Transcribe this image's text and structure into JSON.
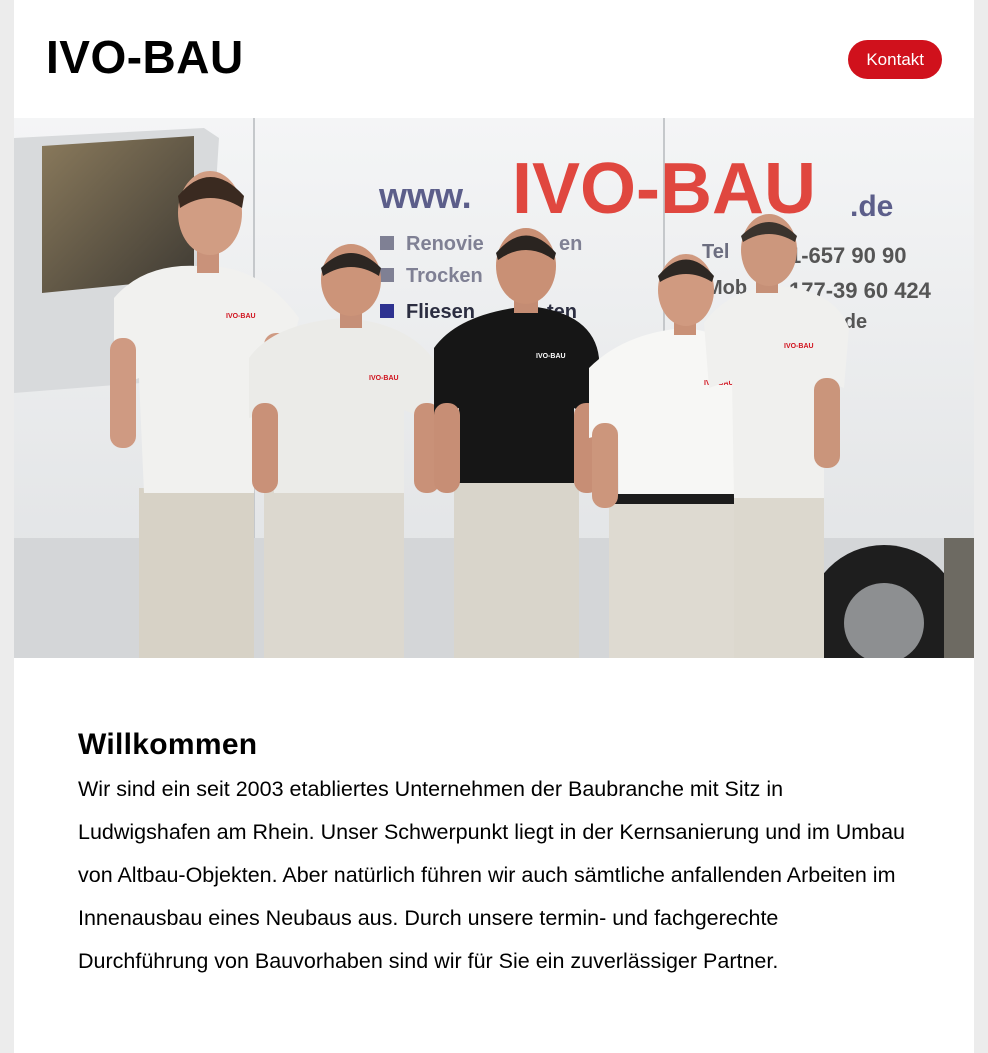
{
  "header": {
    "logo": "IVO-BAU",
    "contact_button": "Kontakt"
  },
  "hero": {
    "van_url_prefix": "www.",
    "van_brand": "IVO-BAU",
    "van_url_suffix": ".de",
    "van_services": [
      "Renovie",
      "Trocken",
      "Fliesen"
    ],
    "van_services_tail": [
      "en",
      "",
      "ten"
    ],
    "van_tel": "Tel",
    "van_tel_number": "1-657 90 90",
    "van_mobile": "Mob",
    "van_mobile_number": "177-39 60 424",
    "van_web_tail": "u.de",
    "shirt_logo": "IVO-BAU",
    "colors": {
      "brand_red": "#d0111c",
      "van_white": "#eef0f2"
    }
  },
  "welcome": {
    "title": "Willkommen",
    "text": "Wir sind ein seit 2003 etabliertes Unternehmen der Baubranche mit Sitz in Ludwigshafen am Rhein. Unser Schwerpunkt liegt in der Kernsanierung und im Umbau von Altbau-Objekten. Aber natürlich führen wir auch sämtliche anfallenden Arbeiten im Innenausbau eines Neubaus aus. Durch unsere termin- und fachgerechte Durchführung von Bauvorhaben sind wir für Sie ein zuverlässiger Partner."
  }
}
